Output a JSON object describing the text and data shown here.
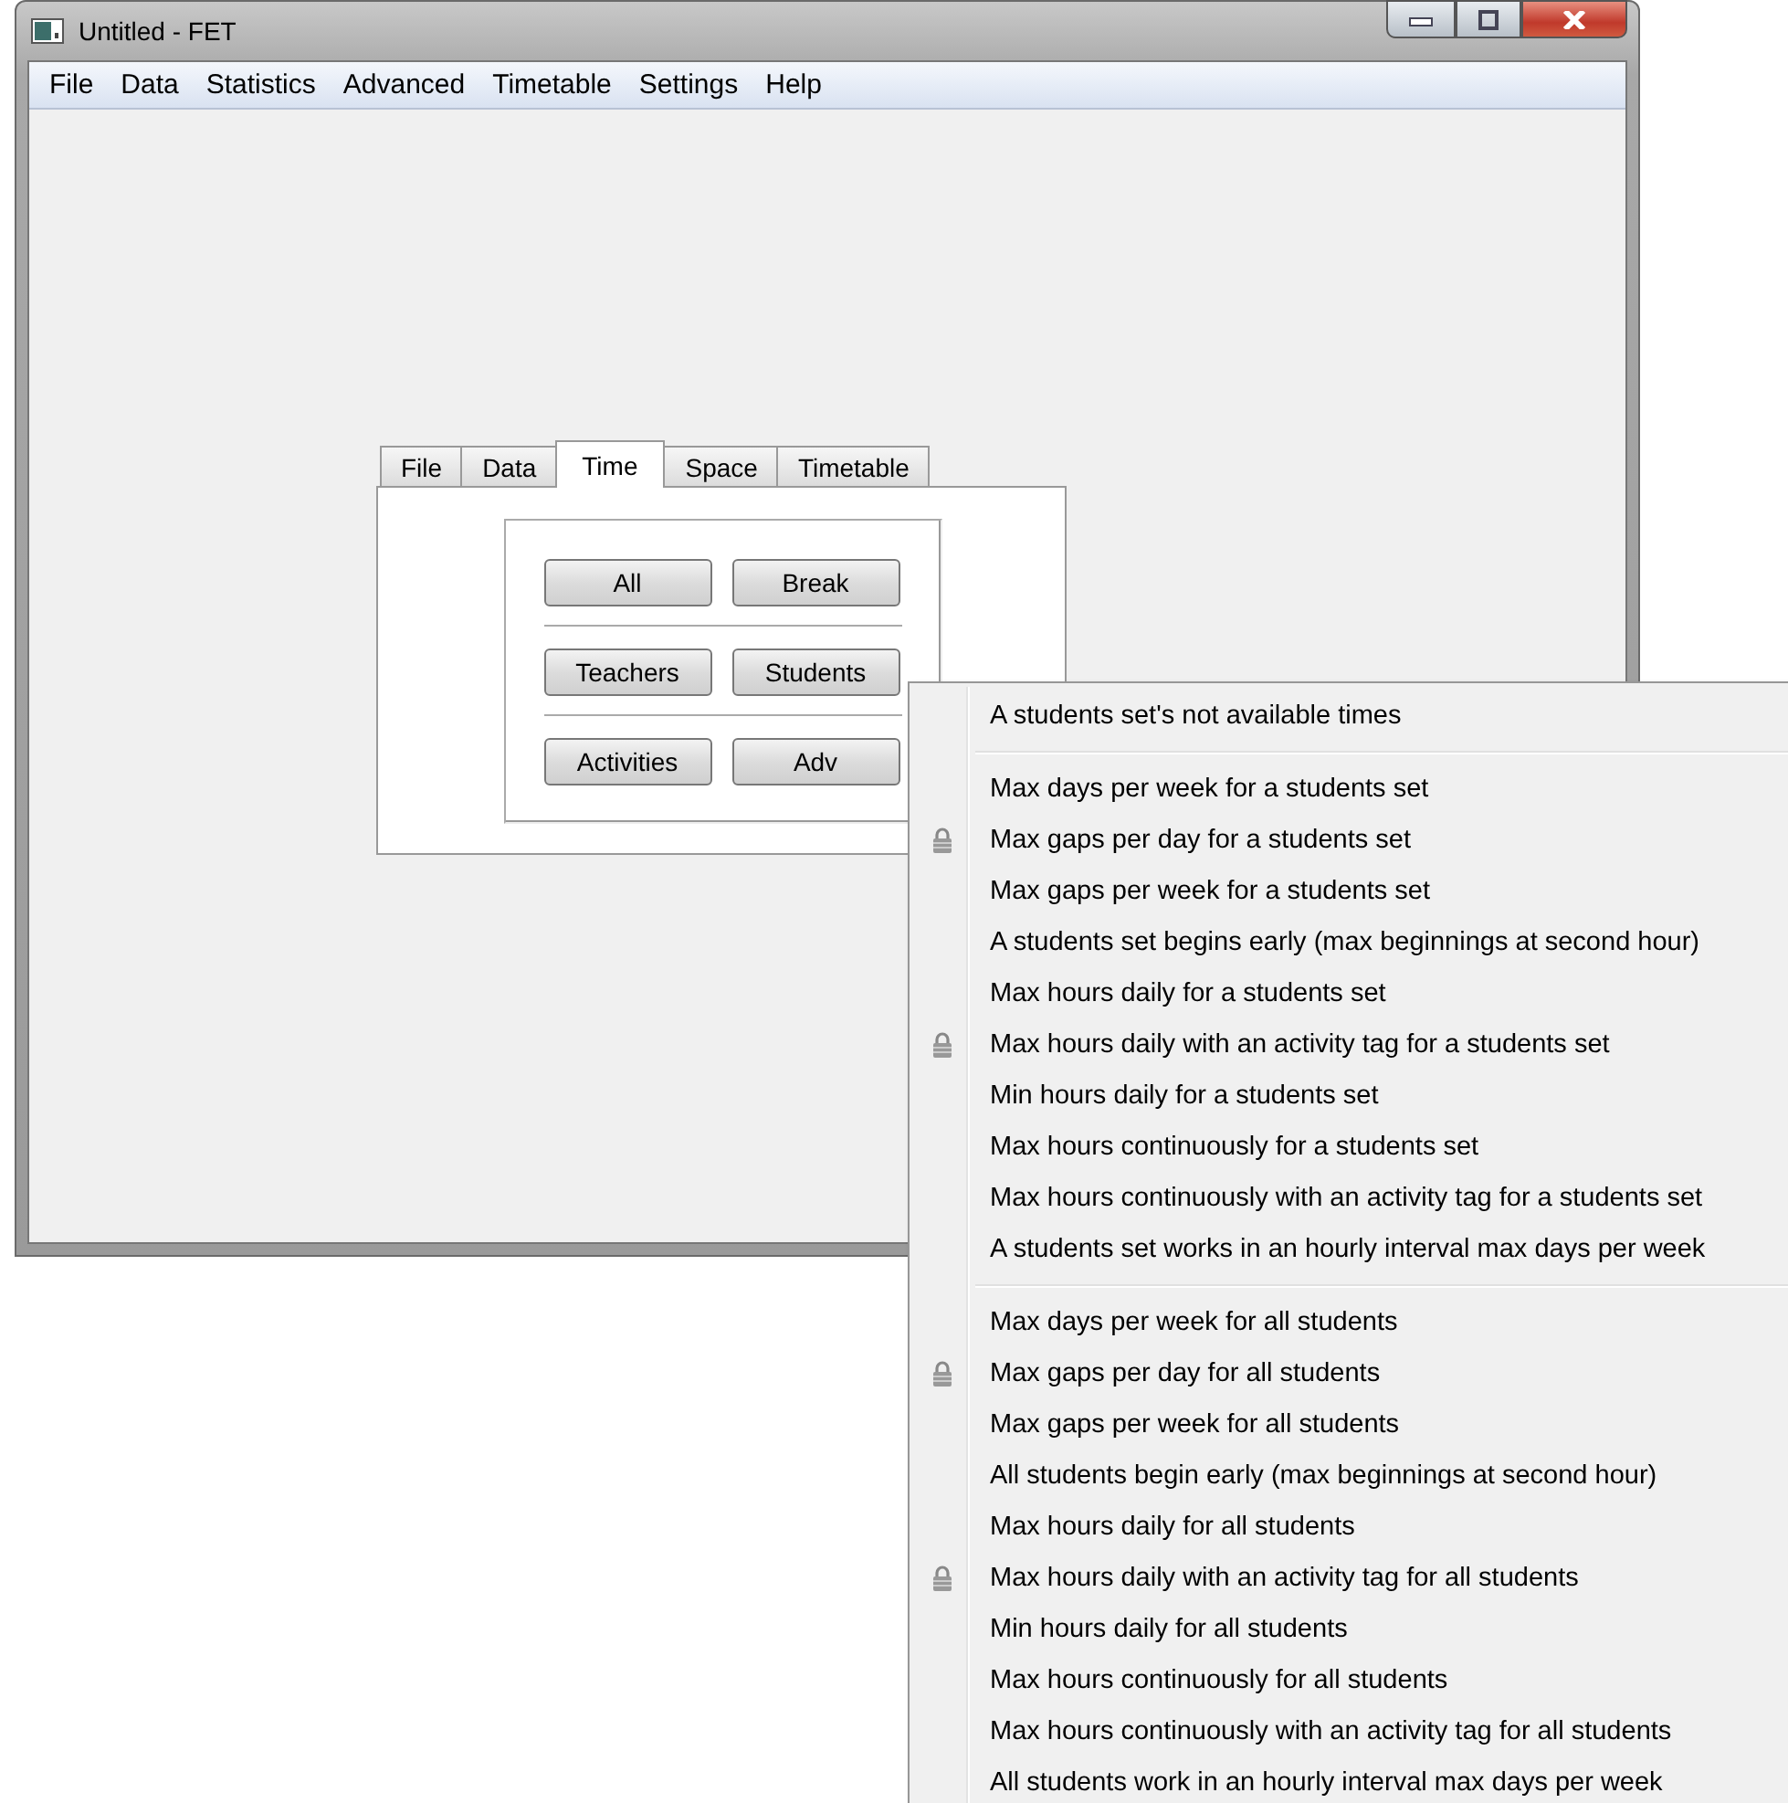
{
  "window": {
    "title": "Untitled - FET"
  },
  "menu_bar": [
    "File",
    "Data",
    "Statistics",
    "Advanced",
    "Timetable",
    "Settings",
    "Help"
  ],
  "tabs": [
    {
      "label": "File",
      "selected": false
    },
    {
      "label": "Data",
      "selected": false
    },
    {
      "label": "Time",
      "selected": true
    },
    {
      "label": "Space",
      "selected": false
    },
    {
      "label": "Timetable",
      "selected": false
    }
  ],
  "button_rows": [
    [
      "All",
      "Break"
    ],
    [
      "Teachers",
      "Students"
    ],
    [
      "Activities",
      "Adv"
    ]
  ],
  "popup_menu": [
    [
      {
        "label": "A students set's not available times",
        "locked": false
      }
    ],
    [
      {
        "label": "Max days per week for a students set",
        "locked": false
      },
      {
        "label": "Max gaps per day for a students set",
        "locked": true
      },
      {
        "label": "Max gaps per week for a students set",
        "locked": false
      },
      {
        "label": "A students set begins early (max beginnings at second hour)",
        "locked": false
      },
      {
        "label": "Max hours daily for a students set",
        "locked": false
      },
      {
        "label": "Max hours daily with an activity tag for a students set",
        "locked": true
      },
      {
        "label": "Min hours daily for a students set",
        "locked": false
      },
      {
        "label": "Max hours continuously for a students set",
        "locked": false
      },
      {
        "label": "Max hours continuously with an activity tag for a students set",
        "locked": false
      },
      {
        "label": "A students set works in an hourly interval max days per week",
        "locked": false
      }
    ],
    [
      {
        "label": "Max days per week for all students",
        "locked": false
      },
      {
        "label": "Max gaps per day for all students",
        "locked": true
      },
      {
        "label": "Max gaps per week for all students",
        "locked": false
      },
      {
        "label": "All students begin early (max beginnings at second hour)",
        "locked": false
      },
      {
        "label": "Max hours daily for all students",
        "locked": false
      },
      {
        "label": "Max hours daily with an activity tag for all students",
        "locked": true
      },
      {
        "label": "Min hours daily for all students",
        "locked": false
      },
      {
        "label": "Max hours continuously for all students",
        "locked": false
      },
      {
        "label": "Max hours continuously with an activity tag for all students",
        "locked": false
      },
      {
        "label": "All students work in an hourly interval max days per week",
        "locked": false
      }
    ]
  ]
}
